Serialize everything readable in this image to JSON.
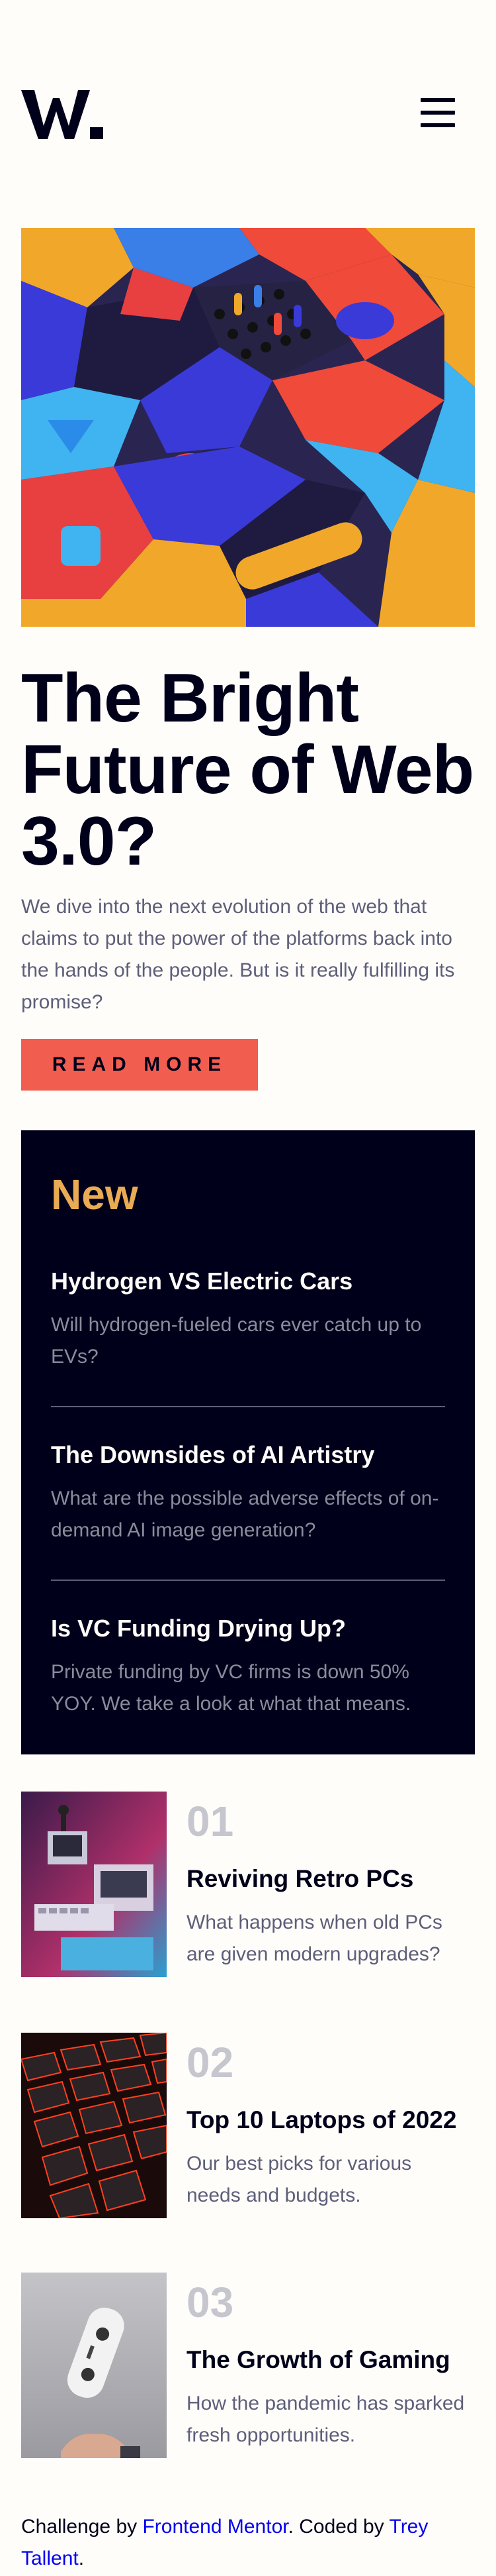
{
  "header": {
    "logo_text": "W.",
    "menu_icon": "hamburger-menu-icon"
  },
  "hero": {
    "title": "The Bright Future of Web 3.0?",
    "description": "We dive into the next evolution of the web that claims to put the power of the platforms back into the hands of the people. But is it really fulfilling its promise?",
    "button_label": "READ MORE"
  },
  "new_section": {
    "heading": "New",
    "items": [
      {
        "title": "Hydrogen VS Electric Cars",
        "description": "Will hydrogen-fueled cars ever catch up to EVs?"
      },
      {
        "title": "The Downsides of AI Artistry",
        "description": "What are the possible adverse effects of on-demand AI image generation?"
      },
      {
        "title": "Is VC Funding Drying Up?",
        "description": "Private funding by VC firms is down 50% YOY. We take a look at what that means."
      }
    ]
  },
  "articles": [
    {
      "number": "01",
      "title": "Reviving Retro PCs",
      "description": "What happens when old PCs are given modern upgrades?"
    },
    {
      "number": "02",
      "title": "Top 10 Laptops of 2022",
      "description": "Our best picks for various needs and budgets."
    },
    {
      "number": "03",
      "title": "The Growth of Gaming",
      "description": "How the pandemic has sparked fresh opportunities."
    }
  ],
  "attribution": {
    "prefix": "Challenge by ",
    "link1": "Frontend Mentor",
    "middle": ". Coded by ",
    "link2": "Trey Tallent",
    "suffix": "."
  },
  "colors": {
    "accent_red": "#f15e50",
    "accent_orange": "#e9ab53",
    "dark_navy": "#00001a",
    "grayish_blue": "#5d5f79",
    "off_white": "#fffdfa"
  }
}
